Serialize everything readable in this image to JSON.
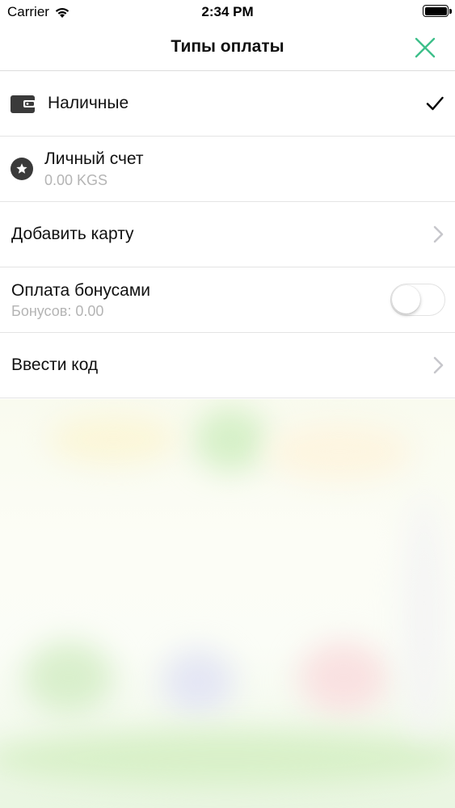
{
  "status_bar": {
    "carrier": "Carrier",
    "time": "2:34 PM"
  },
  "nav": {
    "title": "Типы оплаты",
    "close_icon": "close-icon",
    "accent_color": "#3dbf8a"
  },
  "payment_options": [
    {
      "title": "Наличные",
      "icon": "wallet-icon",
      "selected": true
    },
    {
      "title": "Личный счет",
      "subtitle": "0.00 KGS",
      "icon": "star-circle-icon"
    },
    {
      "title": "Добавить карту",
      "accessory": "chevron-right-icon"
    },
    {
      "title": "Оплата бонусами",
      "subtitle": "Бонусов: 0.00",
      "toggle_on": false
    },
    {
      "title": "Ввести код",
      "accessory": "chevron-right-icon"
    }
  ]
}
